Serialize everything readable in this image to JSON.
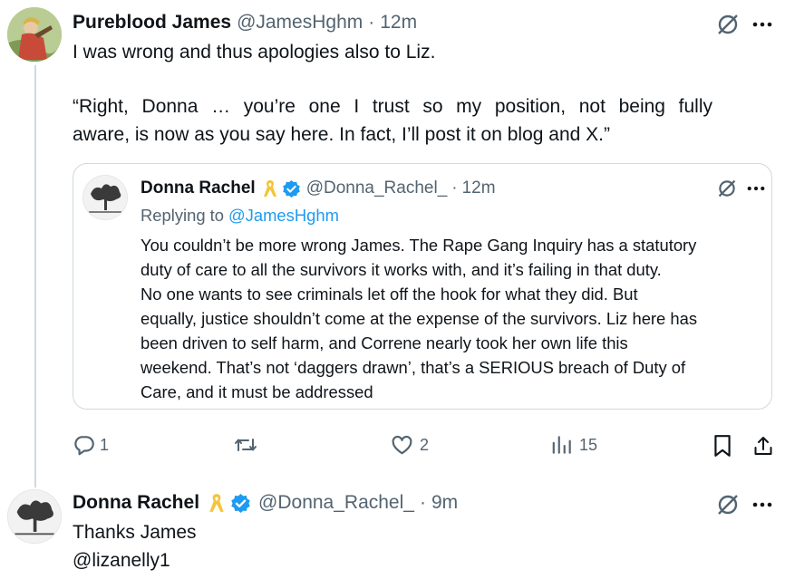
{
  "first_tweet": {
    "display_name": "Pureblood James",
    "handle": "@JamesHghm",
    "separator": "·",
    "time": "12m",
    "text_line1": "I was wrong and thus apologies also to Liz.",
    "text_para2_line1": "“Right, Donna … you’re one I trust so my position, not being fully",
    "text_para2_line2": "aware, is now as you say here. In fact, I’ll post it on blog and X.”"
  },
  "quoted_tweet": {
    "display_name": "Donna Rachel",
    "ribbon_icon": "yellow-ribbon-icon",
    "verified_icon": "verified-badge-icon",
    "handle": "@Donna_Rachel_",
    "separator": "·",
    "time": "12m",
    "replying_prefix": "Replying to",
    "replying_handle": "@JamesHghm",
    "lines": [
      "You couldn’t be more wrong James. The Rape Gang Inquiry has a statutory",
      "duty of care to all the survivors it works with, and it’s failing in that duty.",
      "No one wants to see criminals let off the hook for what they did. But",
      "equally, justice shouldn’t come at the expense of the survivors. Liz here has",
      "been driven to self harm, and Correne nearly took her own life this",
      "weekend. That’s not ‘daggers drawn’, that’s a SERIOUS breach of Duty of",
      "Care, and it must be addressed"
    ]
  },
  "actions": {
    "replies": "1",
    "reposts": "",
    "likes": "2",
    "views": "15"
  },
  "reply_tweet": {
    "display_name": "Donna Rachel",
    "handle": "@Donna_Rachel_",
    "separator": "·",
    "time": "9m",
    "text": "Thanks James",
    "mention": "@lizanelly1"
  },
  "colors": {
    "accent": "#1d9bf0",
    "muted": "#536471",
    "ribbon": "#f4c43a",
    "border": "#cfd9de"
  }
}
